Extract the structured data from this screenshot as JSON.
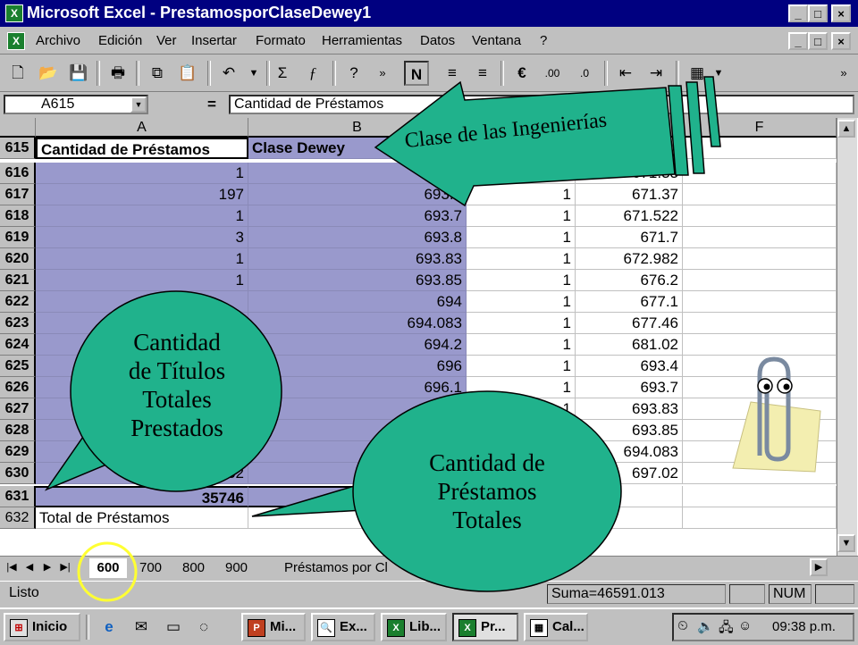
{
  "window": {
    "title": "Microsoft Excel - PrestamosporClaseDewey1",
    "controls": [
      "_",
      "□",
      "×"
    ]
  },
  "menu": {
    "items": [
      "Archivo",
      "Edición",
      "Ver",
      "Insertar",
      "Formato",
      "Herramientas",
      "Datos",
      "Ventana",
      "?"
    ],
    "doc_controls": [
      "_",
      "□",
      "×"
    ]
  },
  "formula_bar": {
    "cell_ref": "A615",
    "equals": "=",
    "content": "Cantidad de Préstamos"
  },
  "sheet": {
    "columns": [
      "A",
      "B",
      "F"
    ],
    "header_row": {
      "row": "615",
      "a": "Cantidad de Préstamos",
      "b": "Clase Dewey"
    },
    "rows": [
      {
        "row": "616",
        "a": "1",
        "b": "693.4",
        "d": "1",
        "e": "671.33"
      },
      {
        "row": "617",
        "a": "197",
        "b": "693.5",
        "d": "1",
        "e": "671.37"
      },
      {
        "row": "618",
        "a": "1",
        "b": "693.7",
        "d": "1",
        "e": "671.522"
      },
      {
        "row": "619",
        "a": "3",
        "b": "693.8",
        "d": "1",
        "e": "671.7"
      },
      {
        "row": "620",
        "a": "1",
        "b": "693.83",
        "d": "1",
        "e": "672.982"
      },
      {
        "row": "621",
        "a": "1",
        "b": "693.85",
        "d": "1",
        "e": "676.2"
      },
      {
        "row": "622",
        "a": "",
        "b": "694",
        "d": "1",
        "e": "677.1"
      },
      {
        "row": "623",
        "a": "",
        "b": "694.083",
        "d": "1",
        "e": "677.46"
      },
      {
        "row": "624",
        "a": "",
        "b": "694.2",
        "d": "1",
        "e": "681.02"
      },
      {
        "row": "625",
        "a": "",
        "b": "696",
        "d": "1",
        "e": "693.4"
      },
      {
        "row": "626",
        "a": "",
        "b": "696.1",
        "d": "1",
        "e": "693.7"
      },
      {
        "row": "627",
        "a": "",
        "b": "697",
        "d": "1",
        "e": "693.83"
      },
      {
        "row": "628",
        "a": "",
        "b": "6",
        "d": "",
        "e": "693.85"
      },
      {
        "row": "629",
        "a": "3",
        "b": "",
        "d": "",
        "e": "694.083"
      },
      {
        "row": "630",
        "a": "52",
        "b": "",
        "d": "",
        "e": "697.02"
      }
    ],
    "total_row": {
      "row": "631",
      "a": "35746"
    },
    "label_row": {
      "row": "632",
      "a": "Total de Préstamos"
    }
  },
  "tabs": {
    "items": [
      "600",
      "700",
      "800",
      "900",
      "Préstamos por Cl"
    ],
    "active": "600"
  },
  "status": {
    "ready": "Listo",
    "sum": "Suma=46591.013",
    "num": "NUM"
  },
  "taskbar": {
    "start": "Inicio",
    "buttons": [
      "Mi...",
      "Ex...",
      "Lib...",
      "Pr...",
      "Cal..."
    ],
    "clock": "09:38 p.m."
  },
  "annotations": {
    "arrow_label": "Clase de las Ingenierías",
    "bubble_left": [
      "Cantidad",
      "de Títulos",
      "Totales",
      "Prestados"
    ],
    "bubble_right": [
      "Cantidad de",
      "Préstamos",
      "Totales"
    ]
  },
  "colors": {
    "titlebar": "#000080",
    "selection": "#9999cc",
    "callout": "#20b28c",
    "highlight_circle": "#ffff33"
  }
}
